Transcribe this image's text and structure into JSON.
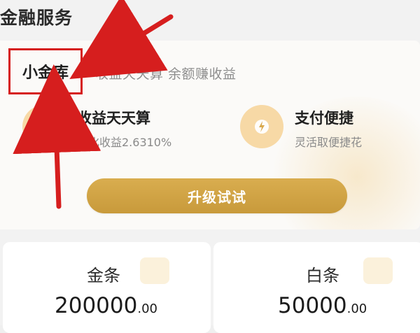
{
  "header": {
    "title": "金融服务"
  },
  "card": {
    "active_tab": "小金库",
    "tab_description": "收益天天算 余额赚收益",
    "features": [
      {
        "title": "收益天天算",
        "subtitle": "年化收益2.6310%",
        "icon": "wallet-icon"
      },
      {
        "title": "支付便捷",
        "subtitle": "灵活取便捷花",
        "icon": "lightning-icon"
      }
    ],
    "button_label": "升级试试"
  },
  "bottom_cards": [
    {
      "label": "金条",
      "amount_main": "200000",
      "amount_cents": ".00"
    },
    {
      "label": "白条",
      "amount_main": "50000",
      "amount_cents": ".00"
    }
  ],
  "colors": {
    "background": "#f2f2f2",
    "card": "#fbfaf8",
    "accent": "#d6a645",
    "icon_bg": "#f7d9a6",
    "highlight_red": "#d61e1e"
  }
}
